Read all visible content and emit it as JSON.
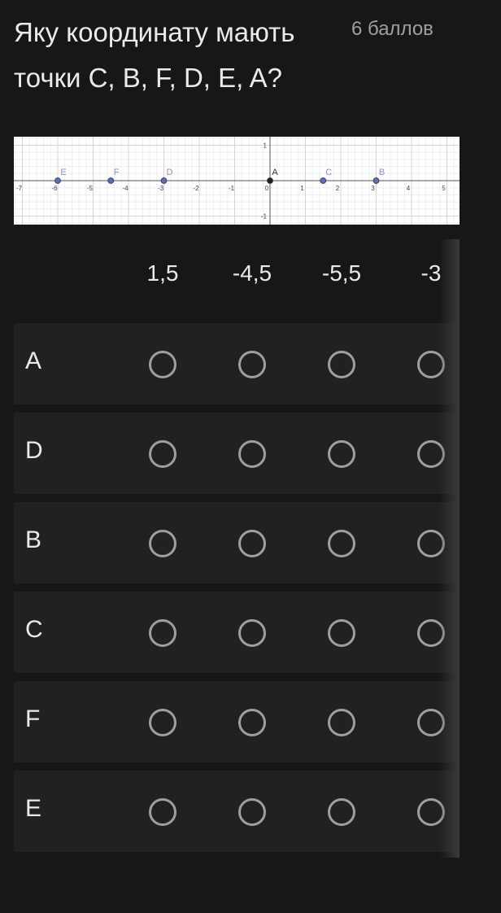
{
  "question": {
    "title": "Яку координату мають точки C, B, F, D, E, A?",
    "points": "6 баллов"
  },
  "figure": {
    "x_ticks": [
      "-7",
      "-6",
      "-5",
      "-4",
      "-3",
      "-2",
      "-1",
      "0",
      "1",
      "2",
      "3",
      "4",
      "5"
    ],
    "y_ticks": [
      "1",
      "-1"
    ],
    "points": [
      {
        "label": "E",
        "x": -6,
        "color": "#5c6bc0"
      },
      {
        "label": "F",
        "x": -4.5,
        "color": "#5c6bc0"
      },
      {
        "label": "D",
        "x": -3,
        "color": "#5c6bc0"
      },
      {
        "label": "A",
        "x": 0,
        "color": "#222222"
      },
      {
        "label": "C",
        "x": 1.5,
        "color": "#5c6bc0"
      },
      {
        "label": "B",
        "x": 3,
        "color": "#5c6bc0"
      }
    ]
  },
  "grid": {
    "columns": [
      "1,5",
      "-4,5",
      "-5,5",
      "-3"
    ],
    "rows": [
      "A",
      "D",
      "B",
      "C",
      "F",
      "E"
    ]
  },
  "colors": {
    "background": "#171717",
    "row_background": "#212121",
    "radio_border": "#9aa0a6"
  }
}
